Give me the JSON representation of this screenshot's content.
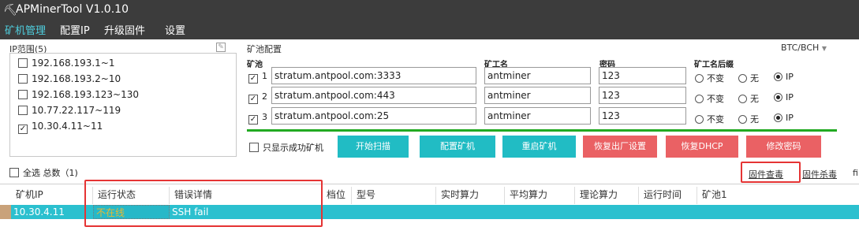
{
  "app": {
    "title": "APMinerTool V1.0.10",
    "icon": "miner-pick-icon"
  },
  "menu": [
    {
      "label": "矿机管理",
      "active": true
    },
    {
      "label": "配置IP",
      "active": false
    },
    {
      "label": "升级固件",
      "active": false
    },
    {
      "label": "设置",
      "active": false
    }
  ],
  "ip_panel": {
    "title": "IP范围(5)",
    "edit_icon": "edit-icon",
    "items": [
      {
        "label": "192.168.193.1~1",
        "checked": false
      },
      {
        "label": "192.168.193.2~10",
        "checked": false
      },
      {
        "label": "192.168.193.123~130",
        "checked": false
      },
      {
        "label": "10.77.22.117~119",
        "checked": false
      },
      {
        "label": "10.30.4.11~11",
        "checked": true
      }
    ]
  },
  "pool_config": {
    "title": "矿池配置",
    "coin": "BTC/BCH",
    "columns": {
      "pool": "矿池",
      "worker": "矿工名",
      "password": "密码",
      "suffix": "矿工名后缀"
    },
    "rows": [
      {
        "num": "1",
        "checked": true,
        "pool": "stratum.antpool.com:3333",
        "worker": "antminer",
        "password": "123",
        "suffix": "IP"
      },
      {
        "num": "2",
        "checked": true,
        "pool": "stratum.antpool.com:443",
        "worker": "antminer",
        "password": "123",
        "suffix": "IP"
      },
      {
        "num": "3",
        "checked": true,
        "pool": "stratum.antpool.com:25",
        "worker": "antminer",
        "password": "123",
        "suffix": "IP"
      }
    ],
    "suffix_options": [
      "不变",
      "无",
      "IP"
    ]
  },
  "actions": {
    "only_success": "只显示成功矿机",
    "scan": "开始扫描",
    "config": "配置矿机",
    "reboot": "重启矿机",
    "factory": "恢复出厂设置",
    "dhcp": "恢复DHCP",
    "password": "修改密码"
  },
  "list": {
    "select_all": "全选",
    "total": "总数（1)",
    "firmware_check": "固件查毒",
    "firmware_kill": "固件杀毒",
    "more": "fi"
  },
  "table": {
    "headers": [
      "矿机IP",
      "运行状态",
      "错误详情",
      "档位",
      "型号",
      "实时算力",
      "平均算力",
      "理论算力",
      "运行时间",
      "矿池1"
    ],
    "rows": [
      {
        "ip": "10.30.4.11",
        "status": "不在线",
        "error": "SSH fail"
      }
    ]
  },
  "colors": {
    "accent": "#21bcc4",
    "danger": "#ea6164",
    "highlight": "#e53434",
    "row": "#2bc0cf"
  }
}
